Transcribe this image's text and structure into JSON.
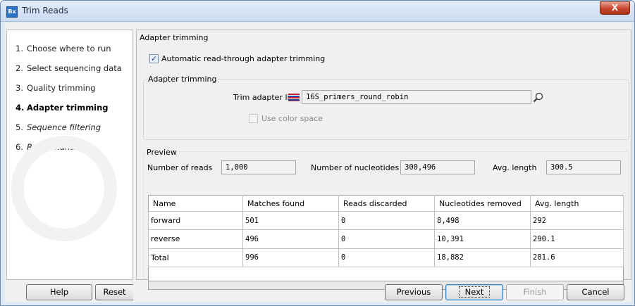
{
  "window": {
    "title": "Trim Reads",
    "app_icon": "Bx",
    "close": "X"
  },
  "steps": [
    {
      "num": "1.",
      "label": "Choose where to run"
    },
    {
      "num": "2.",
      "label": "Select sequencing data"
    },
    {
      "num": "3.",
      "label": "Quality trimming"
    },
    {
      "num": "4.",
      "label": "Adapter trimming"
    },
    {
      "num": "5.",
      "label": "Sequence filtering"
    },
    {
      "num": "6.",
      "label": "Result handling"
    }
  ],
  "section_title": "Adapter trimming",
  "auto_trim": {
    "label": "Automatic read-through adapter trimming",
    "checked": true
  },
  "adapter_group": {
    "label": "Adapter trimming",
    "trim_list_label": "Trim adapter list",
    "trim_list_value": "16S_primers_round_robin",
    "color_space_label": "Use color space"
  },
  "preview": {
    "label": "Preview",
    "num_reads_label": "Number of reads",
    "num_reads": "1,000",
    "num_nuc_label": "Number of nucleotides",
    "num_nuc": "300,496",
    "avg_len_label": "Avg. length",
    "avg_len": "300.5",
    "columns": [
      "Name",
      "Matches found",
      "Reads discarded",
      "Nucleotides removed",
      "Avg. length"
    ],
    "rows": [
      [
        "forward",
        "501",
        "0",
        "8,498",
        "292"
      ],
      [
        "reverse",
        "496",
        "0",
        "10,391",
        "290.1"
      ],
      [
        "Total",
        "996",
        "0",
        "18,882",
        "281.6"
      ]
    ]
  },
  "buttons": {
    "help": "Help",
    "reset": "Reset",
    "previous": "Previous",
    "next": "Next",
    "finish": "Finish",
    "cancel": "Cancel"
  },
  "colors": {
    "title_bg": "#c9daf0",
    "close": "#c6452c"
  }
}
